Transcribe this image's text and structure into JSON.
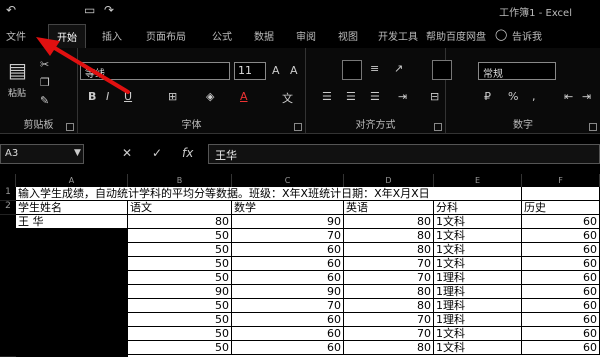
{
  "titlebar": {
    "title": "工作簿1 - Excel"
  },
  "tabs": [
    {
      "label": "文件"
    },
    {
      "label": "开始"
    },
    {
      "label": "插入"
    },
    {
      "label": "页面布局"
    },
    {
      "label": "公式"
    },
    {
      "label": "数据"
    },
    {
      "label": "审阅"
    },
    {
      "label": "视图"
    },
    {
      "label": "开发工具"
    },
    {
      "label": "帮助"
    },
    {
      "label": "百度网盘"
    },
    {
      "label": "告诉我"
    }
  ],
  "ribbon": {
    "clipboard_label": "剪贴板",
    "paste_label": "粘贴",
    "font_label": "字体",
    "font_name": "等线",
    "font_size": "11",
    "align_label": "对齐方式",
    "number_label": "数字",
    "number_format": "常规"
  },
  "formula_bar": {
    "cell_ref": "A3",
    "content": "王华"
  },
  "sheet": {
    "columns": [
      "A",
      "B",
      "C",
      "D",
      "E",
      "F"
    ],
    "row1_text": "输入学生成绩，自动统计学科的平均分等数据。班级：X年X班统计日期：X年X月X日",
    "headers": [
      "学生姓名",
      "语文",
      "数学",
      "英语",
      "分科",
      "历史"
    ],
    "rows": [
      {
        "name": "王      华",
        "yw": "80",
        "sx": "90",
        "yy": "80",
        "fk": "1文科",
        "ls": "60"
      },
      {
        "name": "",
        "yw": "50",
        "sx": "70",
        "yy": "80",
        "fk": "1文科",
        "ls": "60"
      },
      {
        "name": "",
        "yw": "50",
        "sx": "60",
        "yy": "80",
        "fk": "1文科",
        "ls": "60"
      },
      {
        "name": "",
        "yw": "50",
        "sx": "60",
        "yy": "70",
        "fk": "1文科",
        "ls": "60"
      },
      {
        "name": "",
        "yw": "50",
        "sx": "60",
        "yy": "70",
        "fk": "1理科",
        "ls": "60"
      },
      {
        "name": "",
        "yw": "90",
        "sx": "90",
        "yy": "80",
        "fk": "1理科",
        "ls": "60"
      },
      {
        "name": "",
        "yw": "50",
        "sx": "70",
        "yy": "80",
        "fk": "1理科",
        "ls": "60"
      },
      {
        "name": "",
        "yw": "50",
        "sx": "60",
        "yy": "70",
        "fk": "1理科",
        "ls": "60"
      },
      {
        "name": "",
        "yw": "50",
        "sx": "60",
        "yy": "70",
        "fk": "1文科",
        "ls": "60"
      },
      {
        "name": "",
        "yw": "50",
        "sx": "60",
        "yy": "80",
        "fk": "1文科",
        "ls": "60"
      }
    ]
  },
  "colors": {
    "annotation_arrow": "#e01010"
  }
}
